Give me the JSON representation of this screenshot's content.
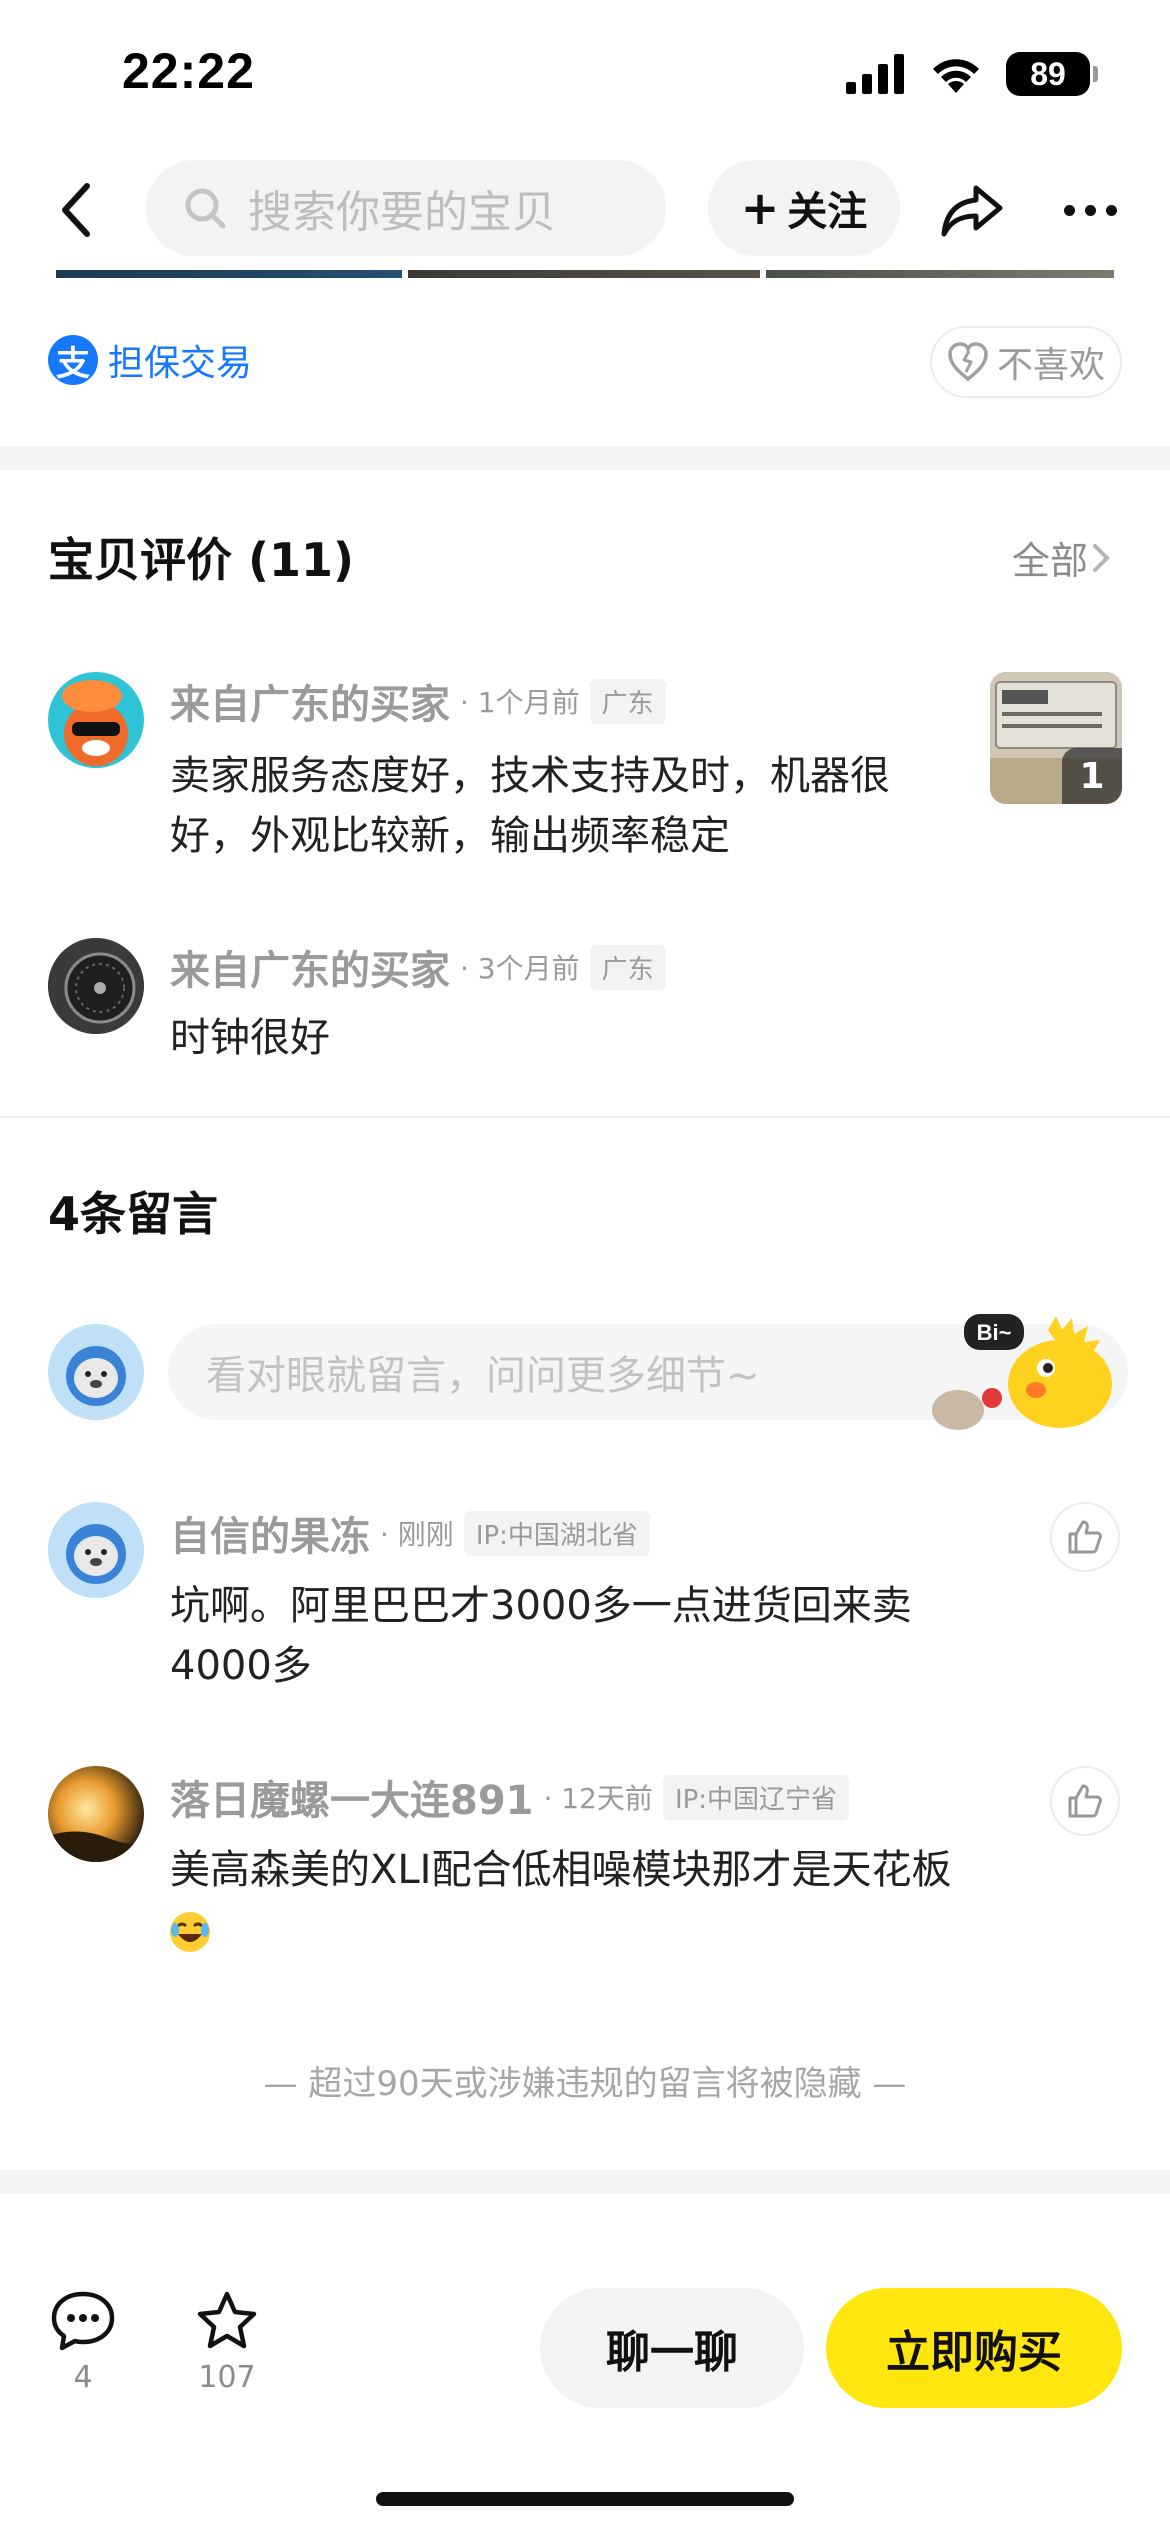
{
  "status_bar": {
    "time": "22:22",
    "battery": "89"
  },
  "nav": {
    "search_placeholder": "搜索你要的宝贝",
    "follow_label": "关注"
  },
  "guarantee": {
    "icon_glyph": "支",
    "label": "担保交易"
  },
  "dislike_label": "不喜欢",
  "reviews": {
    "title": "宝贝评价 (11)",
    "all_label": "全部",
    "items": [
      {
        "name": "来自广东的买家",
        "time": "· 1个月前",
        "tag": "广东",
        "text_line1": "卖家服务态度好，技术支持及时，机器很",
        "text_line2": "好，外观比较新，输出频率稳定",
        "photo_count": "1"
      },
      {
        "name": "来自广东的买家",
        "time": "· 3个月前",
        "tag": "广东",
        "text_line1": "时钟很好"
      }
    ]
  },
  "comments": {
    "title": "4条留言",
    "input_placeholder": "看对眼就留言，问问更多细节~",
    "mascot_bubble": "Bi~",
    "items": [
      {
        "name": "自信的果冻",
        "time": "· 刚刚",
        "tag": "IP:中国湖北省",
        "text_line1": "坑啊。阿里巴巴才3000多一点进货回来卖",
        "text_line2": "4000多"
      },
      {
        "name": "落日魔螺一大连891",
        "time": "· 12天前",
        "tag": "IP:中国辽宁省",
        "text_line1": "美高森美的XLI配合低相噪模块那才是天花板",
        "emoji": "😂"
      }
    ],
    "footer_note": "— 超过90天或涉嫌违规的留言将被隐藏 —"
  },
  "bottom_bar": {
    "comment_count": "4",
    "favorite_count": "107",
    "chat_label": "聊一聊",
    "buy_label": "立即购买"
  },
  "colors": {
    "brand_yellow": "#ffe60f",
    "link_blue": "#1677ff",
    "muted_text": "#9a9a9a"
  }
}
